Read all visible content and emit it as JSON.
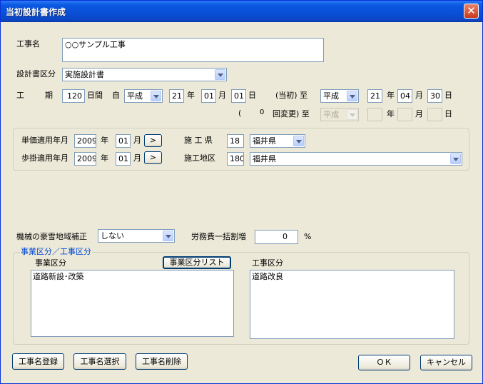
{
  "window": {
    "title": "当初設計書作成",
    "close_glyph": "✕"
  },
  "construction_name": {
    "label": "工事名",
    "value": "○○サンプル工事"
  },
  "design_type": {
    "label": "設計書区分",
    "value": "実施設計書"
  },
  "period": {
    "label_ko": "工",
    "label_ki": "期",
    "days": "120",
    "days_unit": "日間",
    "from_label": "自",
    "era": "平成",
    "year": "21",
    "year_unit": "年",
    "month": "01",
    "month_unit": "月",
    "day": "01",
    "day_unit": "日",
    "initial_label": "(当初) 至",
    "end_era": "平成",
    "end_year": "21",
    "end_month": "04",
    "end_day": "30"
  },
  "revision": {
    "open_paren": "(",
    "count": "0",
    "label": "回変更) 至",
    "era": "平成",
    "year": "",
    "month": "",
    "day": "",
    "year_unit": "年",
    "month_unit": "月",
    "day_unit": "日"
  },
  "price": {
    "unit_label": "単価適用年月",
    "unit_year": "2009",
    "unit_month": "01",
    "rate_label": "歩掛適用年月",
    "rate_year": "2009",
    "rate_month": "01",
    "year_unit": "年",
    "month_unit": "月",
    "arrow": ">",
    "pref_label": "施 工 県",
    "pref_code": "18",
    "pref_name": "福井県",
    "area_label": "施工地区",
    "area_code": "180",
    "area_name": "福井県"
  },
  "snow": {
    "label": "機械の豪雪地域補正",
    "value": "しない"
  },
  "labor": {
    "label": "労務費一括割増",
    "value": "0",
    "unit": "%"
  },
  "category": {
    "group_title": "事業区分／工事区分",
    "business_label": "事業区分",
    "business_list_button": "事業区分リスト",
    "business_items": [
      "道路新設･改築"
    ],
    "work_label": "工事区分",
    "work_items": [
      "道路改良"
    ]
  },
  "buttons": {
    "register": "工事名登録",
    "select": "工事名選択",
    "delete": "工事名削除",
    "ok": "ＯＫ",
    "cancel": "キャンセル"
  },
  "colors": {
    "title_bar": "#0a4fd6",
    "window_bg": "#ece9d8",
    "group_title": "#0046d5"
  }
}
